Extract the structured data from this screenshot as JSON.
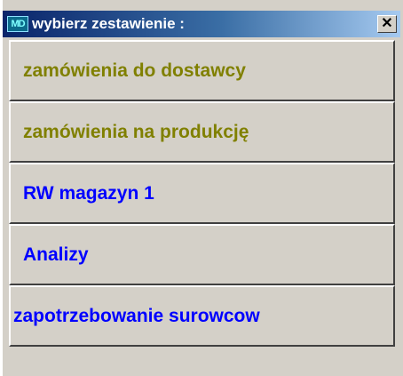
{
  "window": {
    "title": "wybierz zestawienie :",
    "icon": "app-icon",
    "icon_text": "MD",
    "close_glyph": "✕"
  },
  "menu": {
    "items": [
      {
        "label": "zamówienia do dostawcy",
        "color": "#808000"
      },
      {
        "label": "zamówienia na produkcję",
        "color": "#808000"
      },
      {
        "label": "RW magazyn 1",
        "color": "#0000ff"
      },
      {
        "label": "Analizy",
        "color": "#0000ff"
      },
      {
        "label": "zapotrzebowanie surowcow",
        "color": "#0000ff"
      }
    ]
  }
}
